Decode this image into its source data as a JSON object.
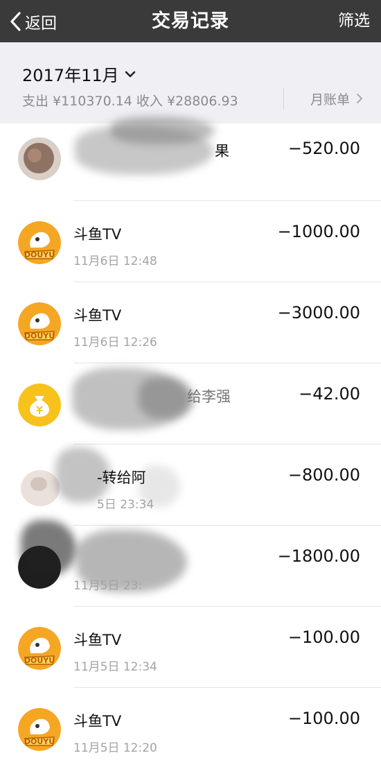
{
  "navbar": {
    "back_label": "返回",
    "title": "交易记录",
    "filter_label": "筛选"
  },
  "summary": {
    "month": "2017年11月",
    "totals_text": "支出 ¥110370.14 收入 ¥28806.93",
    "bill_label": "月账单"
  },
  "transactions": [
    {
      "name": "果",
      "time": "",
      "amount": "−520.00",
      "avatar": "photo-avatar"
    },
    {
      "name": "斗鱼TV",
      "time": "11月6日 12:48",
      "amount": "−1000.00",
      "avatar": "douyu-icon"
    },
    {
      "name": "斗鱼TV",
      "time": "11月6日 12:26",
      "amount": "−3000.00",
      "avatar": "douyu-icon"
    },
    {
      "name": "给李强",
      "time": "",
      "amount": "−42.00",
      "avatar": "money-bag-icon"
    },
    {
      "name": "-转给阿",
      "time": "5日 23:34",
      "amount": "−800.00",
      "avatar": "photo-avatar"
    },
    {
      "name": "",
      "time": "11月5日 23:",
      "amount": "−1800.00",
      "avatar": "dark-avatar"
    },
    {
      "name": "斗鱼TV",
      "time": "11月5日 12:34",
      "amount": "−100.00",
      "avatar": "douyu-icon"
    },
    {
      "name": "斗鱼TV",
      "time": "11月5日 12:20",
      "amount": "−100.00",
      "avatar": "douyu-icon"
    }
  ],
  "colors": {
    "navbar": "#3a3a3a",
    "summary_bg": "#efeff4",
    "douyu_orange": "#f5a623",
    "money_bag_yellow": "#f7c21c"
  }
}
